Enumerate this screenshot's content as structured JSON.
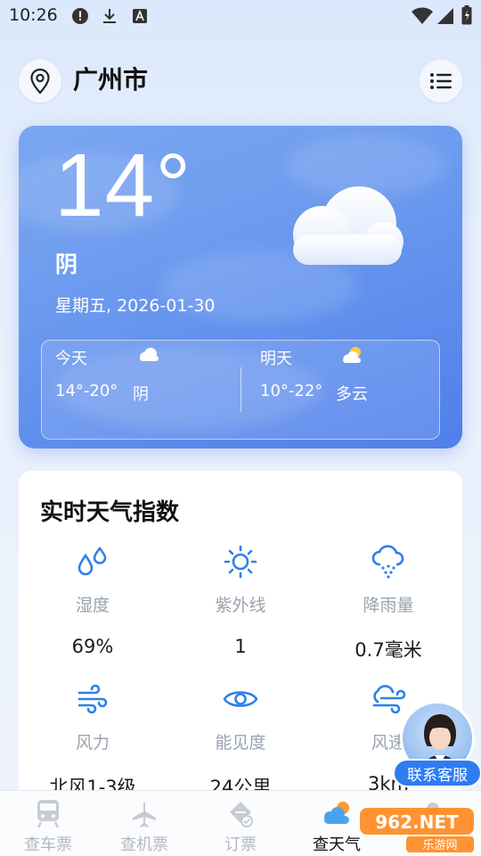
{
  "status_bar": {
    "time": "10:26"
  },
  "header": {
    "city": "广州市"
  },
  "current": {
    "temperature": "14°",
    "condition": "阴",
    "date": "星期五, 2026-01-30"
  },
  "forecast": [
    {
      "day": "今天",
      "range": "14°-20°",
      "condition": "阴",
      "icon": "cloud-icon"
    },
    {
      "day": "明天",
      "range": "10°-22°",
      "condition": "多云",
      "icon": "partly-cloudy-icon"
    }
  ],
  "index_card": {
    "title": "实时天气指数",
    "items": [
      {
        "label": "湿度",
        "value": "69%",
        "icon": "humidity-icon"
      },
      {
        "label": "紫外线",
        "value": "1",
        "icon": "sun-icon"
      },
      {
        "label": "降雨量",
        "value": "0.7毫米",
        "icon": "rain-icon"
      },
      {
        "label": "风力",
        "value": "北风1-3级",
        "icon": "wind-icon"
      },
      {
        "label": "能见度",
        "value": "24公里",
        "icon": "eye-icon"
      },
      {
        "label": "风速",
        "value": "3km",
        "icon": "wind-speed-icon"
      }
    ]
  },
  "customer_service": {
    "label": "联系客服"
  },
  "bottom_nav": [
    {
      "label": "查车票",
      "icon": "train-icon"
    },
    {
      "label": "查机票",
      "icon": "plane-icon"
    },
    {
      "label": "订票",
      "icon": "ticket-icon"
    },
    {
      "label": "查天气",
      "icon": "weather-icon",
      "active": true
    },
    {
      "label": "",
      "icon": "profile-icon"
    }
  ],
  "watermark": {
    "brand": "962.NET",
    "sub": "乐游网"
  },
  "colors": {
    "accent": "#2e7cf0",
    "card_blue": "#6e9cef",
    "icon_blue": "#2f80e8"
  }
}
